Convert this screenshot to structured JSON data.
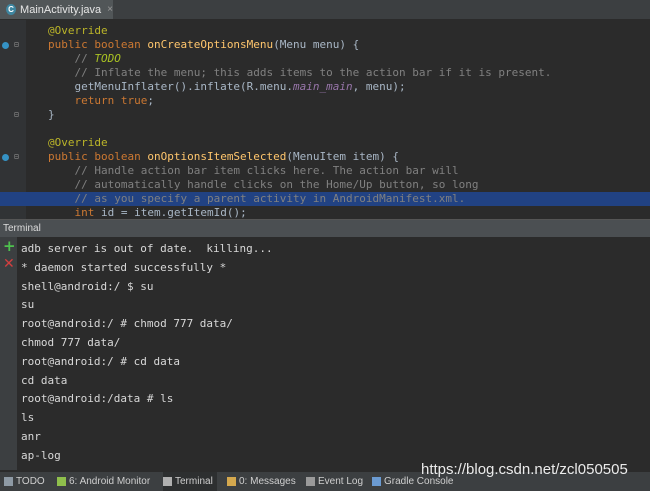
{
  "editor_tab": {
    "icon_letter": "C",
    "label": "MainActivity.java",
    "close": "×"
  },
  "code": [
    [
      {
        "t": "@Override",
        "c": "ann"
      }
    ],
    [
      {
        "t": "public ",
        "c": "kw"
      },
      {
        "t": "boolean ",
        "c": "kw"
      },
      {
        "t": "onCreateOptionsMenu",
        "c": "fn"
      },
      {
        "t": "(Menu menu) {",
        "c": ""
      }
    ],
    [
      {
        "t": "    // ",
        "c": "cm"
      },
      {
        "t": "TODO",
        "c": "todo"
      }
    ],
    [
      {
        "t": "    // Inflate the menu; this adds items to the action bar if it is present.",
        "c": "cm"
      }
    ],
    [
      {
        "t": "    getMenuInflater().inflate(R.menu.",
        "c": ""
      },
      {
        "t": "main_main",
        "c": "it"
      },
      {
        "t": ", menu);",
        "c": ""
      }
    ],
    [
      {
        "t": "    ",
        "c": ""
      },
      {
        "t": "return true",
        "c": "kw"
      },
      {
        "t": ";",
        "c": ""
      }
    ],
    [
      {
        "t": "}",
        "c": ""
      }
    ],
    [
      {
        "t": "",
        "c": ""
      }
    ],
    [
      {
        "t": "@Override",
        "c": "ann"
      }
    ],
    [
      {
        "t": "public ",
        "c": "kw"
      },
      {
        "t": "boolean ",
        "c": "kw"
      },
      {
        "t": "onOptionsItemSelected",
        "c": "fn"
      },
      {
        "t": "(MenuItem item) {",
        "c": ""
      }
    ],
    [
      {
        "t": "    // Handle action bar item clicks here. The action bar will",
        "c": "cm"
      }
    ],
    [
      {
        "t": "    // automatically handle clicks on the Home/Up button, so long",
        "c": "cm"
      }
    ],
    [
      {
        "t": "    // as you specify a parent activity in AndroidManifest.xml.",
        "c": "cm"
      }
    ],
    [
      {
        "t": "    ",
        "c": ""
      },
      {
        "t": "int ",
        "c": "kw"
      },
      {
        "t": "id = item.getItemId();",
        "c": ""
      }
    ]
  ],
  "selected_code_line": 12,
  "terminal": {
    "title": "Terminal",
    "lines": [
      "adb server is out of date.  killing...",
      "* daemon started successfully *",
      "shell@android:/ $ su",
      "su",
      "root@android:/ # chmod 777 data/",
      "chmod 777 data/",
      "root@android:/ # cd data",
      "cd data",
      "root@android:/data # ls",
      "ls",
      "anr",
      "ap-log"
    ]
  },
  "statusbar": {
    "items": [
      {
        "name": "todo",
        "label": "TODO",
        "icon_color": "#8e9aa5"
      },
      {
        "name": "android-monitor",
        "label": "6: Android Monitor",
        "icon_color": "#8fbf4c"
      },
      {
        "name": "terminal",
        "label": "Terminal",
        "icon_color": "#b0b0b0",
        "active": true
      },
      {
        "name": "messages",
        "label": "0: Messages",
        "icon_color": "#d4a84e"
      },
      {
        "name": "event-log",
        "label": "Event Log",
        "icon_color": "#9a9a9a"
      },
      {
        "name": "gradle-console",
        "label": "Gradle Console",
        "icon_color": "#6b9bd2"
      }
    ]
  },
  "watermark": "https://blog.csdn.net/zcl050505"
}
